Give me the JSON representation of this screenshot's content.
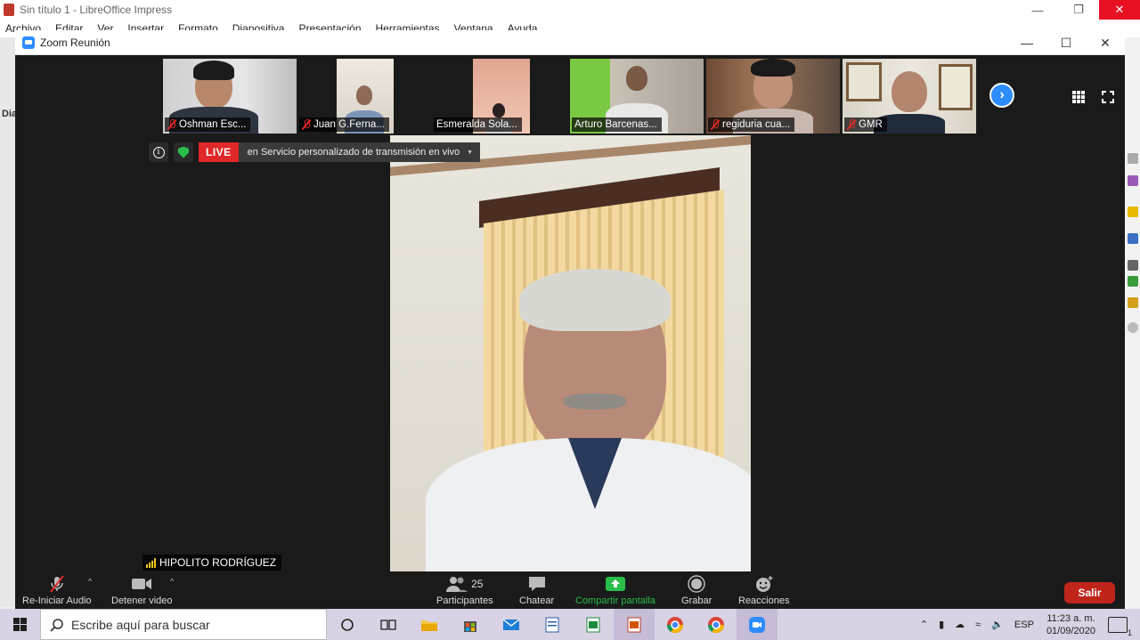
{
  "libreoffice": {
    "title": "Sin título 1 - LibreOffice Impress",
    "menu": [
      "Archivo",
      "Editar",
      "Ver",
      "Insertar",
      "Formato",
      "Diapositiva",
      "Presentación",
      "Herramientas",
      "Ventana",
      "Ayuda"
    ],
    "sidebar_label": "Dia"
  },
  "zoom": {
    "window_title": "Zoom Reunión",
    "thumbnails": [
      {
        "name": "Oshman Esc...",
        "muted": true
      },
      {
        "name": "Juan G.Ferna...",
        "muted": true
      },
      {
        "name": "Esmeralda Sola...",
        "muted": false
      },
      {
        "name": "Arturo Barcenas...",
        "muted": false
      },
      {
        "name": "regiduria cua...",
        "muted": true
      },
      {
        "name": "GMR",
        "muted": true
      }
    ],
    "live": {
      "badge": "LIVE",
      "text": "en Servicio personalizado de transmisión en vivo"
    },
    "active_speaker": "HIPOLITO RODRÍGUEZ",
    "toolbar": {
      "audio_label": "Re-Iniciar Audio",
      "video_label": "Detener video",
      "participants_label": "Participantes",
      "participants_count": "25",
      "chat_label": "Chatear",
      "share_label": "Compartir pantalla",
      "record_label": "Grabar",
      "reactions_label": "Reacciones",
      "leave_label": "Salir"
    },
    "colors": {
      "accent": "#2d8cff",
      "live": "#e02828",
      "share": "#2bbd4a",
      "leave": "#c0251b"
    }
  },
  "taskbar": {
    "search_placeholder": "Escribe aquí para buscar",
    "language": "ESP",
    "time": "11:23 a. m.",
    "date": "01/09/2020",
    "notifications": "1"
  }
}
